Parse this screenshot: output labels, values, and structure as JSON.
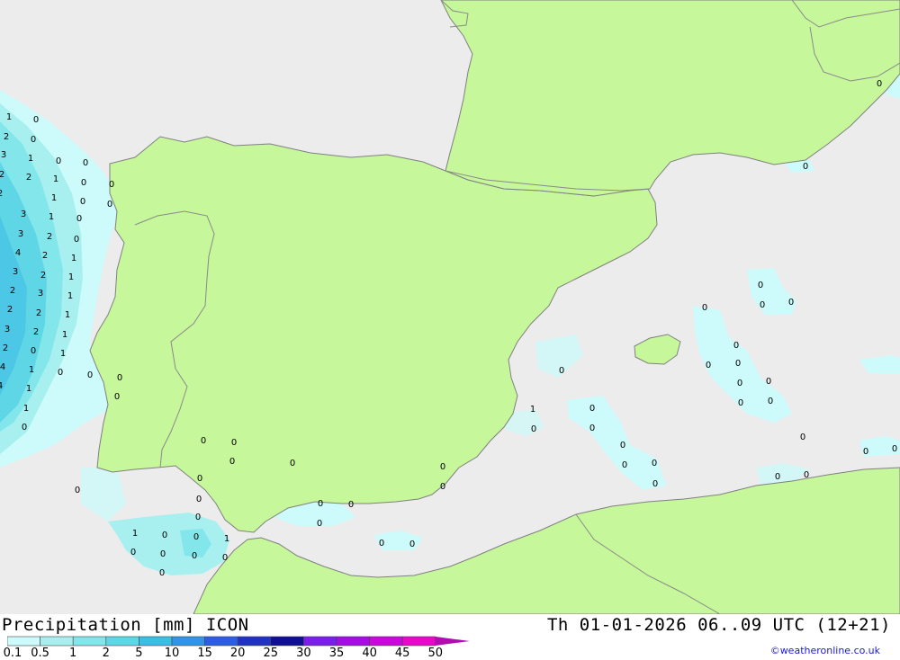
{
  "title": "Precipitation [mm] ICON",
  "valid_time": "Th 01-01-2026 06..09 UTC (12+21)",
  "credit": "©weatheronline.co.uk",
  "colors": {
    "sea": "#ececec",
    "land": "#c6f79a",
    "border": "#8a8a8a",
    "coast": "#808080"
  },
  "legend": {
    "labels": [
      "0.1",
      "0.5",
      "1",
      "2",
      "5",
      "10",
      "15",
      "20",
      "25",
      "30",
      "35",
      "40",
      "45",
      "50"
    ],
    "colors": [
      "#cdfafa",
      "#a8f0f0",
      "#82e6ea",
      "#5fd6e6",
      "#3fbce6",
      "#3294e6",
      "#2c5ee0",
      "#1f33bf",
      "#0f0f8f",
      "#7b1ee6",
      "#a40fe0",
      "#c80ad8",
      "#e60ac8",
      "#b40ab4"
    ]
  },
  "point_values": [
    {
      "v": "1"
    },
    {
      "v": "0"
    },
    {
      "v": "2"
    },
    {
      "v": "0"
    },
    {
      "v": "3"
    },
    {
      "v": "1"
    },
    {
      "v": "0"
    },
    {
      "v": "0"
    },
    {
      "v": "2"
    },
    {
      "v": "2"
    },
    {
      "v": "1"
    },
    {
      "v": "0"
    },
    {
      "v": "0"
    },
    {
      "v": "2"
    },
    {
      "v": "1"
    },
    {
      "v": "0"
    },
    {
      "v": "0"
    },
    {
      "v": "3"
    },
    {
      "v": "1"
    },
    {
      "v": "0"
    },
    {
      "v": "3"
    },
    {
      "v": "2"
    },
    {
      "v": "0"
    },
    {
      "v": "4"
    },
    {
      "v": "2"
    },
    {
      "v": "1"
    },
    {
      "v": "3"
    },
    {
      "v": "2"
    },
    {
      "v": "1"
    },
    {
      "v": "2"
    },
    {
      "v": "3"
    },
    {
      "v": "1"
    },
    {
      "v": "2"
    },
    {
      "v": "2"
    },
    {
      "v": "1"
    },
    {
      "v": "3"
    },
    {
      "v": "2"
    },
    {
      "v": "1"
    },
    {
      "v": "2"
    },
    {
      "v": "0"
    },
    {
      "v": "1"
    },
    {
      "v": "4"
    },
    {
      "v": "1"
    },
    {
      "v": "0"
    },
    {
      "v": "0"
    },
    {
      "v": "0"
    },
    {
      "v": "4"
    },
    {
      "v": "1"
    },
    {
      "v": "0"
    },
    {
      "v": "1"
    },
    {
      "v": "0"
    },
    {
      "v": "0"
    },
    {
      "v": "0"
    },
    {
      "v": "0"
    },
    {
      "v": "0"
    },
    {
      "v": "0"
    },
    {
      "v": "0"
    },
    {
      "v": "0"
    },
    {
      "v": "0"
    },
    {
      "v": "0"
    },
    {
      "v": "0"
    },
    {
      "v": "1"
    },
    {
      "v": "0"
    },
    {
      "v": "0"
    },
    {
      "v": "1"
    },
    {
      "v": "0"
    },
    {
      "v": "0"
    },
    {
      "v": "0"
    },
    {
      "v": "0"
    },
    {
      "v": "0"
    },
    {
      "v": "0"
    },
    {
      "v": "0"
    },
    {
      "v": "0"
    },
    {
      "v": "0"
    },
    {
      "v": "0"
    },
    {
      "v": "0"
    },
    {
      "v": "1"
    },
    {
      "v": "0"
    },
    {
      "v": "0"
    },
    {
      "v": "0"
    },
    {
      "v": "0"
    },
    {
      "v": "0"
    },
    {
      "v": "0"
    },
    {
      "v": "0"
    },
    {
      "v": "0"
    },
    {
      "v": "0"
    },
    {
      "v": "0"
    },
    {
      "v": "0"
    },
    {
      "v": "0"
    },
    {
      "v": "0"
    },
    {
      "v": "0"
    },
    {
      "v": "0"
    },
    {
      "v": "0"
    },
    {
      "v": "0"
    },
    {
      "v": "0"
    },
    {
      "v": "0"
    },
    {
      "v": "0"
    },
    {
      "v": "0"
    },
    {
      "v": "0"
    },
    {
      "v": "0"
    },
    {
      "v": "0"
    },
    {
      "v": "0"
    },
    {
      "v": "0"
    },
    {
      "v": "0"
    },
    {
      "v": "0"
    },
    {
      "v": "0"
    }
  ]
}
